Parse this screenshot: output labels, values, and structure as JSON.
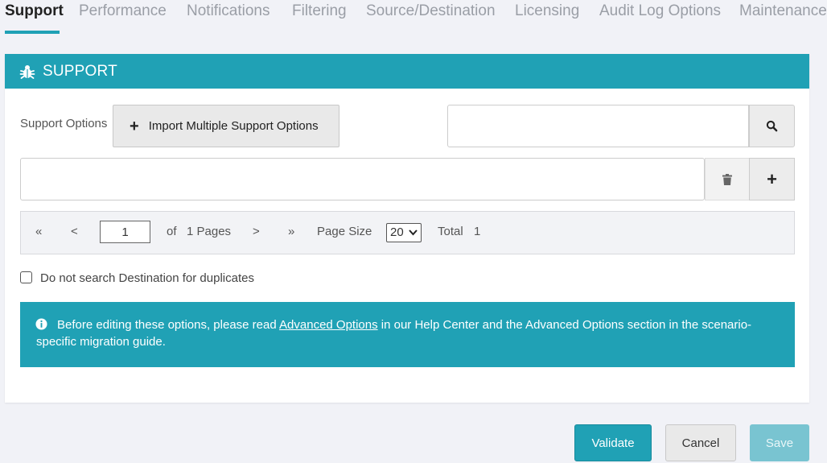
{
  "tabs": [
    {
      "label": "Support",
      "active": true
    },
    {
      "label": "Performance"
    },
    {
      "label": "Notifications"
    },
    {
      "label": "Filtering"
    },
    {
      "label": "Source/Destination"
    },
    {
      "label": "Licensing"
    },
    {
      "label": "Audit Log Options"
    },
    {
      "label": "Maintenance"
    }
  ],
  "panel": {
    "title": "SUPPORT",
    "icon": "bug-icon",
    "support_options_label": "Support Options",
    "import_button_label": "Import Multiple Support Options",
    "search": {
      "value": "",
      "placeholder": ""
    },
    "option_input": {
      "value": "",
      "placeholder": ""
    },
    "pager": {
      "first": "«",
      "prev": "<",
      "current_page": "1",
      "of_label": "of",
      "pages_text": "1 Pages",
      "next": ">",
      "last": "»",
      "page_size_label": "Page Size",
      "page_size_value": "20",
      "total_label": "Total",
      "total_value": "1"
    },
    "checkbox_label": "Do not search Destination for duplicates",
    "checkbox_checked": false,
    "info": {
      "prefix": "Before editing these options, please read ",
      "link": "Advanced Options",
      "suffix": " in our Help Center and the Advanced Options section in the scenario-specific migration guide."
    }
  },
  "footer": {
    "validate": "Validate",
    "cancel": "Cancel",
    "save": "Save"
  },
  "colors": {
    "accent": "#20a1b5",
    "save_disabled": "#79c4d1",
    "background": "#f1f2f7"
  }
}
